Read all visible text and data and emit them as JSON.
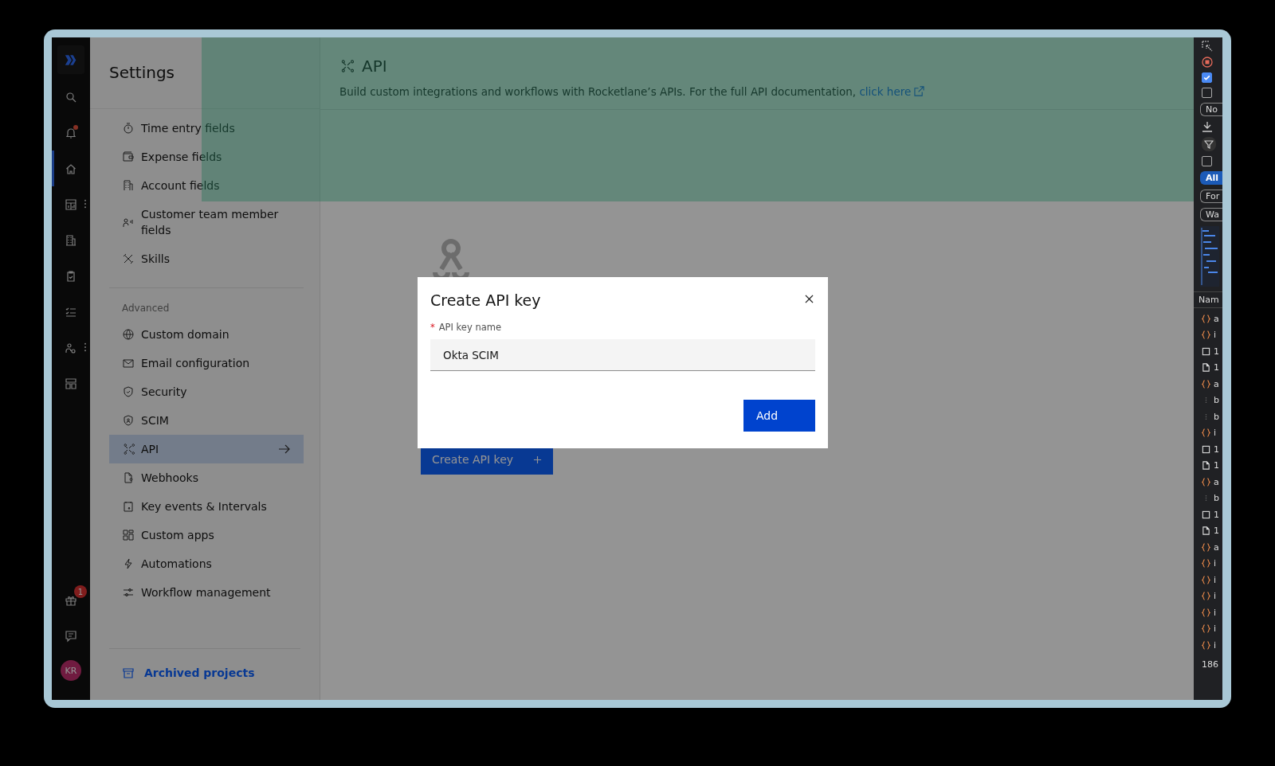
{
  "rail": {
    "items": [
      {
        "selected": false,
        "more": false
      },
      {
        "selected": false,
        "more": false,
        "dot": true
      },
      {
        "selected": true,
        "more": false
      },
      {
        "selected": false,
        "more": true
      },
      {
        "selected": false,
        "more": false
      },
      {
        "selected": false,
        "more": false
      },
      {
        "selected": false,
        "more": false
      },
      {
        "selected": false,
        "more": true
      },
      {
        "selected": false,
        "more": false
      }
    ],
    "bottom": {
      "gift_badge": "1",
      "avatar": "KR"
    }
  },
  "sidebar": {
    "title": "Settings",
    "groups": [
      {
        "items": [
          {
            "label": "Time entry fields",
            "selected": false
          },
          {
            "label": "Expense fields",
            "selected": false
          },
          {
            "label": "Account fields",
            "selected": false
          },
          {
            "label": "Customer team member fields",
            "selected": false
          },
          {
            "label": "Skills",
            "selected": false
          }
        ]
      },
      {
        "heading": "Advanced",
        "items": [
          {
            "label": "Custom domain",
            "selected": false
          },
          {
            "label": "Email configuration",
            "selected": false
          },
          {
            "label": "Security",
            "selected": false
          },
          {
            "label": "SCIM",
            "selected": false
          },
          {
            "label": "API",
            "selected": true
          },
          {
            "label": "Webhooks",
            "selected": false
          },
          {
            "label": "Key events & Intervals",
            "selected": false
          },
          {
            "label": "Custom apps",
            "selected": false
          },
          {
            "label": "Automations",
            "selected": false
          },
          {
            "label": "Workflow management",
            "selected": false
          }
        ]
      }
    ],
    "footer_link": "Archived projects"
  },
  "page": {
    "title": "API",
    "description": "Build custom integrations and workflows with Rocketlane’s APIs. For the full API documentation,",
    "doc_link": "click here",
    "create_button": "Create API key"
  },
  "dialog": {
    "title": "Create API key",
    "field": {
      "label": "API key name",
      "required_mark": "*",
      "value": "Okta SCIM"
    },
    "submit": "Add"
  },
  "devtools": {
    "checkbox_1": true,
    "checkbox_2": false,
    "throttle": "No",
    "checkbox_3": false,
    "filters": [
      {
        "label": "All",
        "selected": true
      },
      {
        "label": "For",
        "selected": false
      },
      {
        "label": "Wa",
        "selected": false
      }
    ],
    "column": "Nam",
    "rows": [
      {
        "kind": "script",
        "text": "a"
      },
      {
        "kind": "script",
        "text": "i"
      },
      {
        "kind": "box",
        "text": "1"
      },
      {
        "kind": "doc",
        "text": "1"
      },
      {
        "kind": "script",
        "text": "a"
      },
      {
        "kind": "dots",
        "text": "b"
      },
      {
        "kind": "dots",
        "text": "b"
      },
      {
        "kind": "script",
        "text": "i"
      },
      {
        "kind": "box",
        "text": "1"
      },
      {
        "kind": "doc",
        "text": "1"
      },
      {
        "kind": "script",
        "text": "a"
      },
      {
        "kind": "dots",
        "text": "b"
      },
      {
        "kind": "box",
        "text": "1"
      },
      {
        "kind": "doc",
        "text": "1"
      },
      {
        "kind": "script",
        "text": "a"
      },
      {
        "kind": "script",
        "text": "i"
      },
      {
        "kind": "script",
        "text": "i"
      },
      {
        "kind": "script",
        "text": "i"
      },
      {
        "kind": "script",
        "text": "i"
      },
      {
        "kind": "script",
        "text": "i"
      },
      {
        "kind": "script",
        "text": "i"
      }
    ],
    "summary": "186"
  }
}
